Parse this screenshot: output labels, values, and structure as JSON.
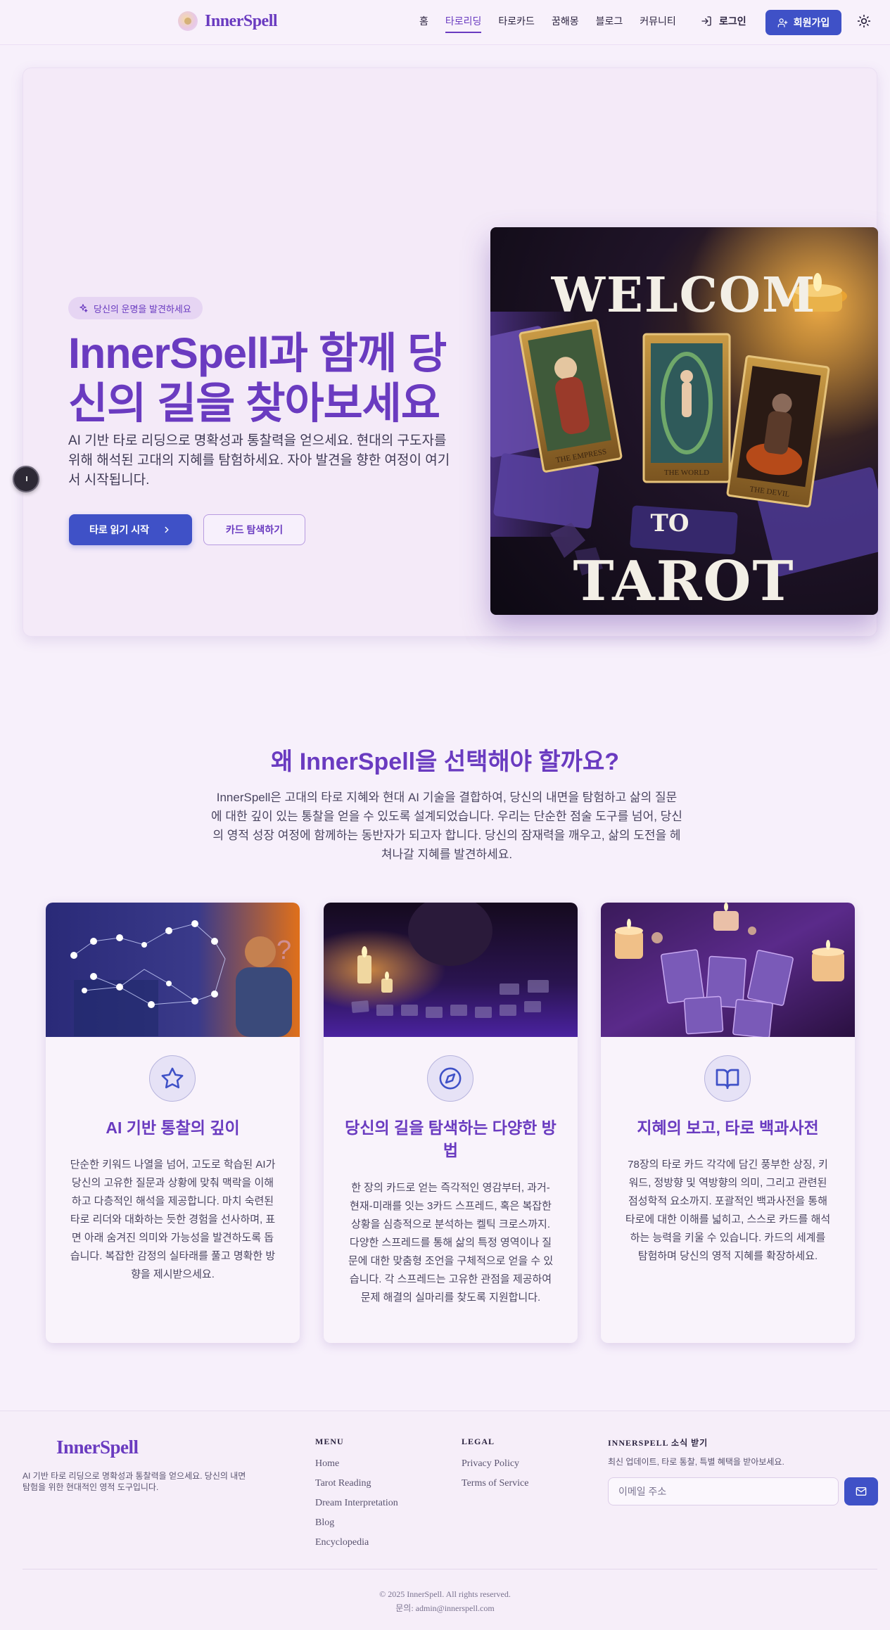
{
  "header": {
    "logo_text": "InnerSpell",
    "nav": [
      "홈",
      "타로리딩",
      "타로카드",
      "꿈해몽",
      "블로그",
      "커뮤니티"
    ],
    "active_nav": "타로리딩",
    "login_label": "로그인",
    "signup_label": "회원가입"
  },
  "hero": {
    "badge": "당신의 운명을 발견하세요",
    "title": "InnerSpell과 함께 당신의 길을 찾아보세요",
    "description": "AI 기반 타로 리딩으로 명확성과 통찰력을 얻으세요. 현대의 구도자를 위해 해석된 고대의 지혜를 탐험하세요. 자아 발견을 향한 여정이 여기서 시작됩니다.",
    "primary_button": "타로 읽기 시작",
    "secondary_button": "카드 탐색하기",
    "image_text_top": "WELCOM",
    "image_text_mid": "TO",
    "image_text_bottom": "TAROT",
    "card_labels": [
      "THE EMPRESS",
      "THE WORLD",
      "THE DEVIL"
    ]
  },
  "why": {
    "title": "왜 InnerSpell을 선택해야 할까요?",
    "description": "InnerSpell은 고대의 타로 지혜와 현대 AI 기술을 결합하여, 당신의 내면을 탐험하고 삶의 질문에 대한 깊이 있는 통찰을 얻을 수 있도록 설계되었습니다. 우리는 단순한 점술 도구를 넘어, 당신의 영적 성장 여정에 함께하는 동반자가 되고자 합니다. 당신의 잠재력을 깨우고, 삶의 도전을 헤쳐나갈 지혜를 발견하세요."
  },
  "cards": [
    {
      "icon": "star-icon",
      "title": "AI 기반 통찰의 깊이",
      "text": "단순한 키워드 나열을 넘어, 고도로 학습된 AI가 당신의 고유한 질문과 상황에 맞춰 맥락을 이해하고 다층적인 해석을 제공합니다. 마치 숙련된 타로 리더와 대화하는 듯한 경험을 선사하며, 표면 아래 숨겨진 의미와 가능성을 발견하도록 돕습니다. 복잡한 감정의 실타래를 풀고 명확한 방향을 제시받으세요."
    },
    {
      "icon": "compass-icon",
      "title": "당신의 길을 탐색하는 다양한 방법",
      "text": "한 장의 카드로 얻는 즉각적인 영감부터, 과거-현재-미래를 잇는 3카드 스프레드, 혹은 복잡한 상황을 심층적으로 분석하는 켈틱 크로스까지. 다양한 스프레드를 통해 삶의 특정 영역이나 질문에 대한 맞춤형 조언을 구체적으로 얻을 수 있습니다. 각 스프레드는 고유한 관점을 제공하여 문제 해결의 실마리를 찾도록 지원합니다."
    },
    {
      "icon": "open-book-icon",
      "title": "지혜의 보고, 타로 백과사전",
      "text": "78장의 타로 카드 각각에 담긴 풍부한 상징, 키워드, 정방향 및 역방향의 의미, 그리고 관련된 점성학적 요소까지. 포괄적인 백과사전을 통해 타로에 대한 이해를 넓히고, 스스로 카드를 해석하는 능력을 키울 수 있습니다. 카드의 세계를 탐험하며 당신의 영적 지혜를 확장하세요."
    }
  ],
  "footer": {
    "logo_text": "InnerSpell",
    "tagline": "AI 기반 타로 리딩으로 명확성과 통찰력을 얻으세요. 당신의 내면 탐험을 위한 현대적인 영적 도구입니다.",
    "menu_heading": "MENU",
    "menu": [
      "Home",
      "Tarot Reading",
      "Dream Interpretation",
      "Blog",
      "Encyclopedia"
    ],
    "legal_heading": "LEGAL",
    "legal": [
      "Privacy Policy",
      "Terms of Service"
    ],
    "news_heading": "INNERSPELL 소식 받기",
    "news_desc": "최신 업데이트, 타로 통찰, 특별 혜택을 받아보세요.",
    "email_placeholder": "이메일 주소",
    "copyright": "© 2025 InnerSpell. All rights reserved.",
    "contact": "문의: admin@innerspell.com"
  },
  "colors": {
    "accent": "#6a3bc0",
    "primary_button": "#3f51c7",
    "background": "#f7f0fb"
  }
}
